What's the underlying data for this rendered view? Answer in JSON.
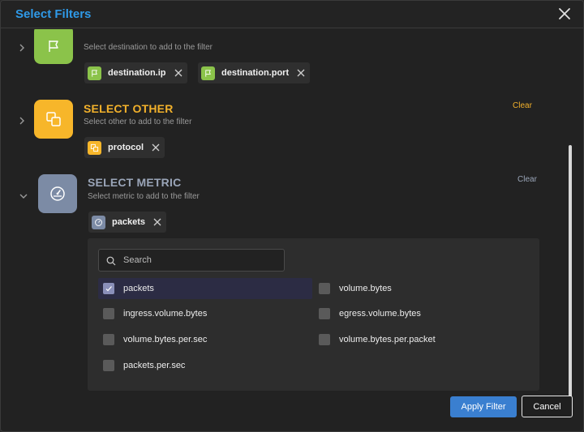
{
  "dialog": {
    "title": "Select Filters",
    "close_icon": "close-icon"
  },
  "sections": {
    "destination": {
      "subtitle": "Select destination to add to the filter",
      "icon": "flag-icon",
      "color": "#8bc34a",
      "chips": [
        {
          "label": "destination.ip"
        },
        {
          "label": "destination.port"
        }
      ]
    },
    "other": {
      "title": "SELECT OTHER",
      "subtitle": "Select other to add to the filter",
      "clear": "Clear",
      "icon": "copy-icon",
      "color": "#f7b62a",
      "chips": [
        {
          "label": "protocol"
        }
      ]
    },
    "metric": {
      "title": "SELECT METRIC",
      "subtitle": "Select metric to add to the filter",
      "clear": "Clear",
      "icon": "gauge-icon",
      "color": "#7c8ba5",
      "chips": [
        {
          "label": "packets"
        }
      ]
    }
  },
  "picker": {
    "search_placeholder": "Search",
    "options": [
      {
        "label": "packets",
        "checked": true
      },
      {
        "label": "volume.bytes",
        "checked": false
      },
      {
        "label": "ingress.volume.bytes",
        "checked": false
      },
      {
        "label": "egress.volume.bytes",
        "checked": false
      },
      {
        "label": "volume.bytes.per.sec",
        "checked": false
      },
      {
        "label": "volume.bytes.per.packet",
        "checked": false
      },
      {
        "label": "packets.per.sec",
        "checked": false
      }
    ]
  },
  "footer": {
    "apply_label": "Apply Filter",
    "cancel_label": "Cancel"
  },
  "colors": {
    "accent_blue": "#2f9ae8",
    "other_title": "#f2b12b",
    "metric_title": "#9aa5b8"
  }
}
